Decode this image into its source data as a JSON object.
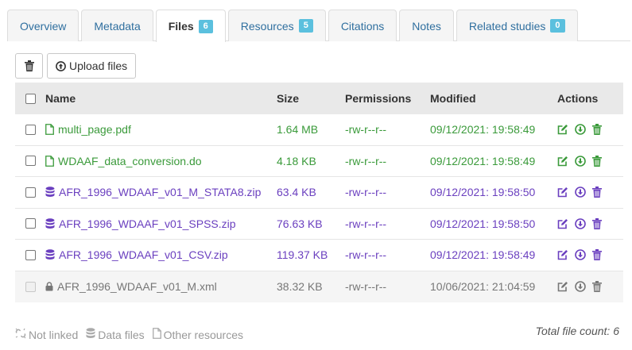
{
  "tabs": [
    {
      "label": "Overview"
    },
    {
      "label": "Metadata"
    },
    {
      "label": "Files",
      "badge": "6"
    },
    {
      "label": "Resources",
      "badge": "5"
    },
    {
      "label": "Citations"
    },
    {
      "label": "Notes"
    },
    {
      "label": "Related studies",
      "badge": "0"
    }
  ],
  "toolbar": {
    "upload_label": "Upload files"
  },
  "table": {
    "headers": {
      "name": "Name",
      "size": "Size",
      "permissions": "Permissions",
      "modified": "Modified",
      "actions": "Actions"
    },
    "rows": [
      {
        "name": "multi_page.pdf",
        "size": "1.64 MB",
        "permissions": "-rw-r--r--",
        "modified": "09/12/2021: 19:58:49",
        "kind": "other",
        "color": "#3a9a3a",
        "icon": "file-icon"
      },
      {
        "name": "WDAAF_data_conversion.do",
        "size": "4.18 KB",
        "permissions": "-rw-r--r--",
        "modified": "09/12/2021: 19:58:49",
        "kind": "other",
        "color": "#3a9a3a",
        "icon": "file-icon"
      },
      {
        "name": "AFR_1996_WDAAF_v01_M_STATA8.zip",
        "size": "63.4 KB",
        "permissions": "-rw-r--r--",
        "modified": "09/12/2021: 19:58:50",
        "kind": "data",
        "color": "#6a3fbf",
        "icon": "database-icon"
      },
      {
        "name": "AFR_1996_WDAAF_v01_SPSS.zip",
        "size": "76.63 KB",
        "permissions": "-rw-r--r--",
        "modified": "09/12/2021: 19:58:50",
        "kind": "data",
        "color": "#6a3fbf",
        "icon": "database-icon"
      },
      {
        "name": "AFR_1996_WDAAF_v01_CSV.zip",
        "size": "119.37 KB",
        "permissions": "-rw-r--r--",
        "modified": "09/12/2021: 19:58:49",
        "kind": "data",
        "color": "#6a3fbf",
        "icon": "database-icon"
      },
      {
        "name": "AFR_1996_WDAAF_v01_M.xml",
        "size": "38.32 KB",
        "permissions": "-rw-r--r--",
        "modified": "10/06/2021: 21:04:59",
        "kind": "locked",
        "color": "#777777",
        "icon": "lock-icon"
      }
    ]
  },
  "legend": {
    "not_linked": "Not linked",
    "data_files": "Data files",
    "other_resources": "Other resources"
  },
  "total": "Total file count: 6",
  "colors": {
    "accent": "#5bc0de",
    "link": "#2f6f9f",
    "other": "#3a9a3a",
    "data": "#6a3fbf",
    "locked": "#777777"
  }
}
